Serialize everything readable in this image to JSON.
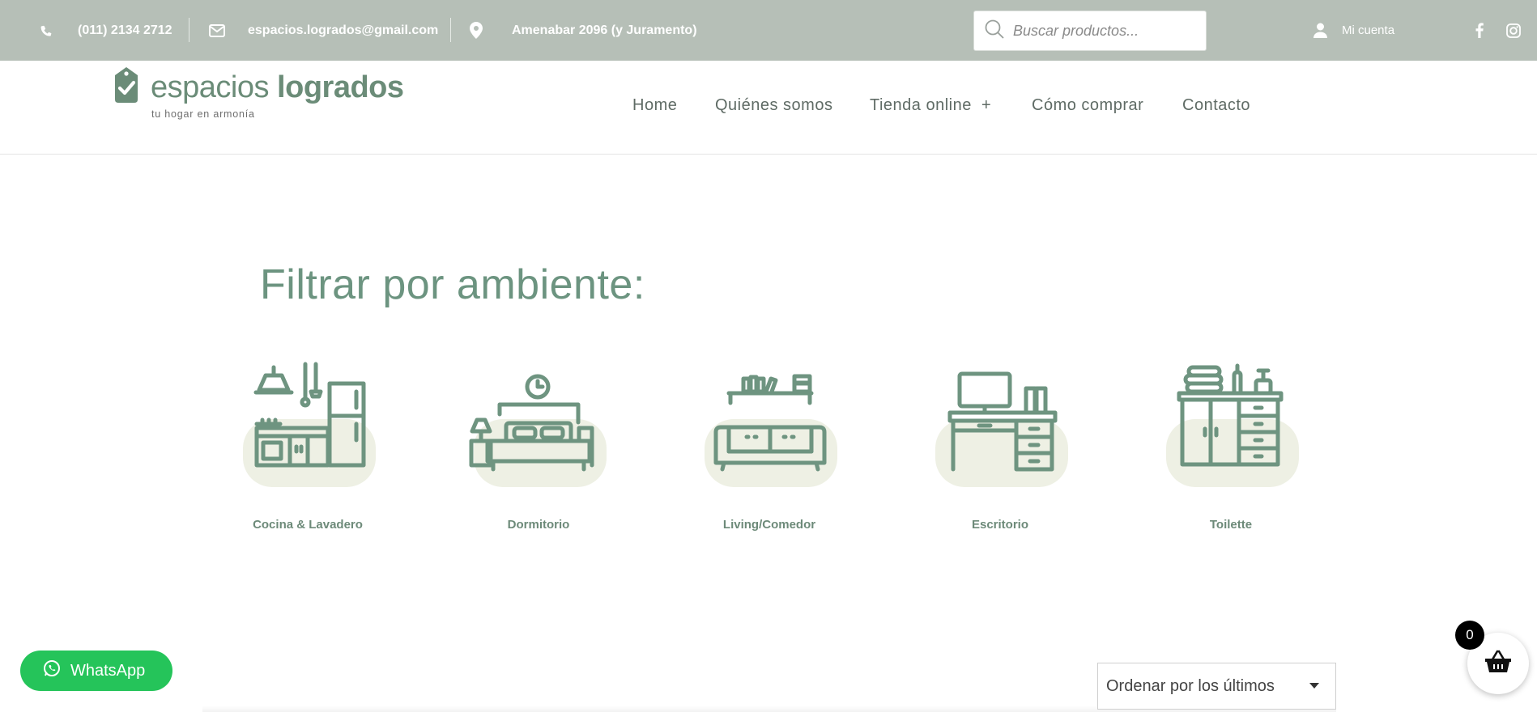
{
  "topbar": {
    "phone": "(011) 2134 2712",
    "email": "espacios.logrados@gmail.com",
    "address": "Amenabar 2096 (y Juramento)",
    "search_placeholder": "Buscar productos...",
    "account": "Mi cuenta"
  },
  "logo": {
    "word_light": "espacios",
    "word_bold": "logrados",
    "tagline": "tu hogar en armonía"
  },
  "nav": {
    "items": [
      {
        "label": "Home"
      },
      {
        "label": "Quiénes somos"
      },
      {
        "label": "Tienda online  +"
      },
      {
        "label": "Cómo comprar"
      },
      {
        "label": "Contacto"
      }
    ]
  },
  "filter": {
    "title": "Filtrar por ambiente:",
    "categories": [
      {
        "label": "Cocina & Lavadero",
        "icon": "kitchen-icon"
      },
      {
        "label": "Dormitorio",
        "icon": "bedroom-icon"
      },
      {
        "label": "Living/Comedor",
        "icon": "sofa-icon"
      },
      {
        "label": "Escritorio",
        "icon": "desk-icon"
      },
      {
        "label": "Toilette",
        "icon": "bathroom-cabinet-icon"
      }
    ]
  },
  "whatsapp": {
    "label": "WhatsApp"
  },
  "sort": {
    "selected": "Ordenar por los últimos"
  },
  "cart": {
    "count": "0"
  },
  "colors": {
    "topbar_bg": "#b6bfb7",
    "brand_green": "#6b8c78",
    "icon_green": "#6e9480",
    "blob": "#eef0e4",
    "whatsapp": "#25c45a"
  }
}
